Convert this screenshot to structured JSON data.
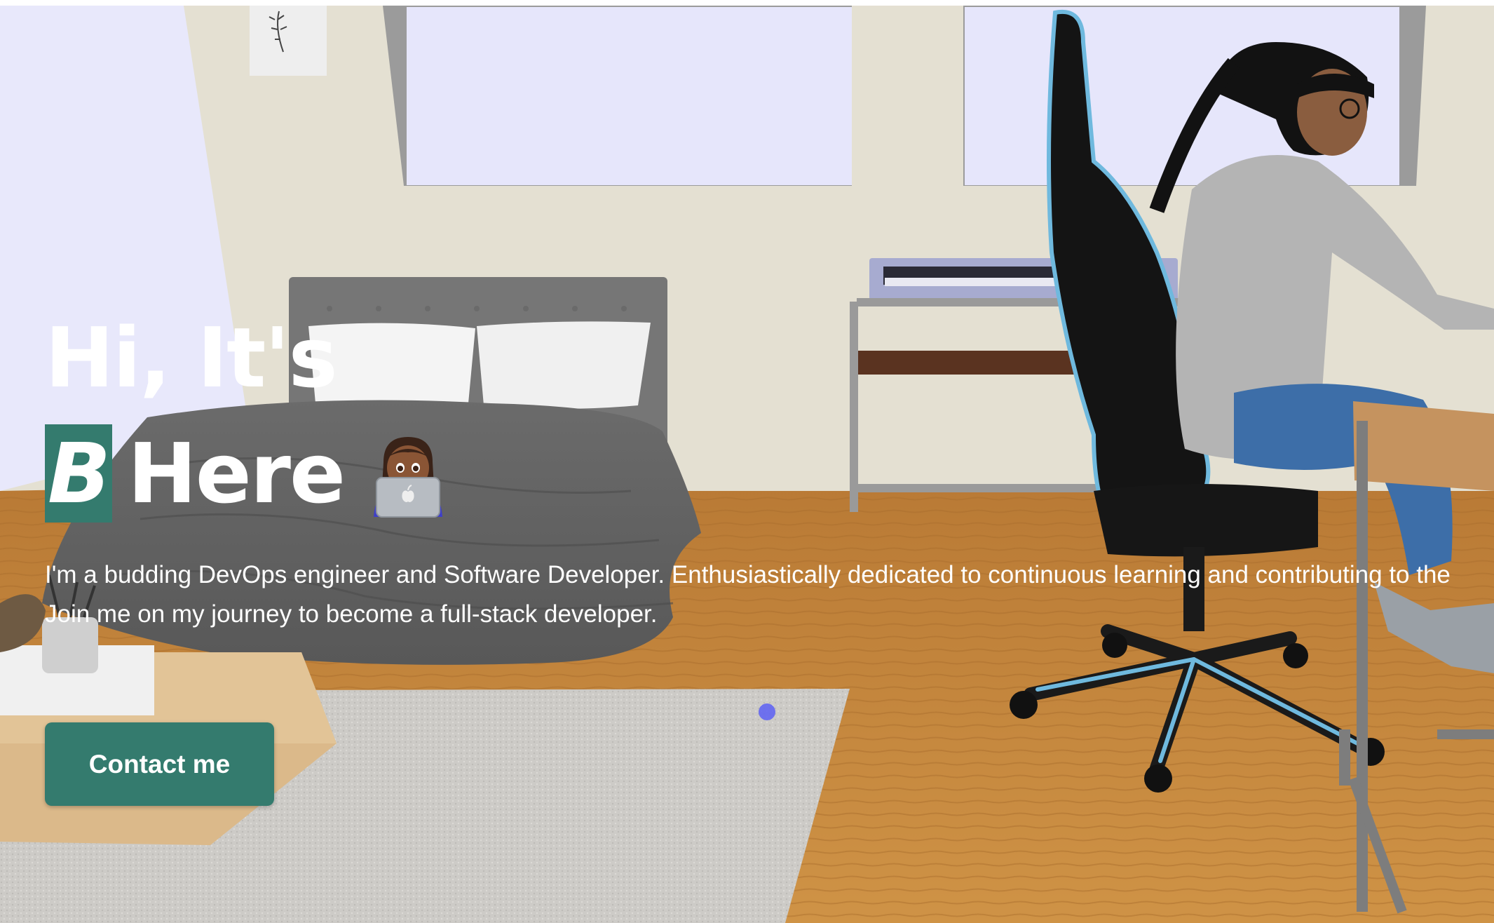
{
  "hero": {
    "greeting": "Hi, It's",
    "initial": "B",
    "name_word": "Here",
    "bio_line_1": "I'm a budding DevOps engineer and Software Developer. Enthusiastically dedicated to continuous learning and contributing to the",
    "bio_line_2": "Join me on my journey to become a full-stack developer.",
    "contact_label": "Contact me"
  },
  "colors": {
    "accent": "#347b6e",
    "wall": "#e4e0d2",
    "window": "#e6e6fb",
    "floor": "#c48a3c",
    "cursor": "#6366f1"
  },
  "icons": {
    "hero_emoji": "woman-technologist-icon"
  }
}
